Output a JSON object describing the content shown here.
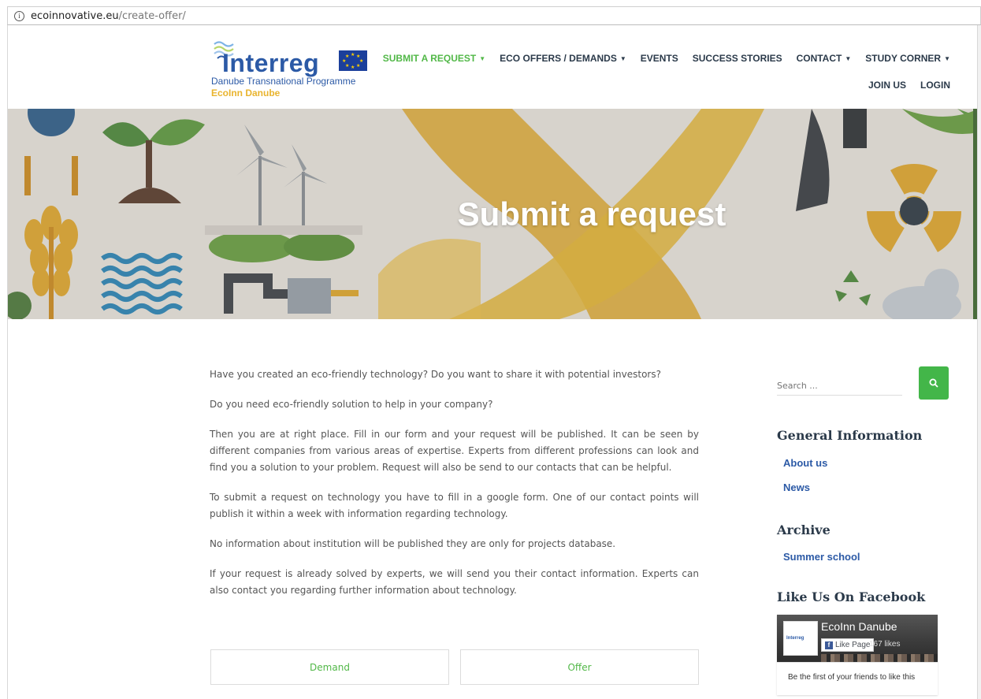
{
  "browser": {
    "url_domain": "ecoinnovative.eu",
    "url_path": "/create-offer/"
  },
  "logo": {
    "word": "Interreg",
    "programme": "Danube Transnational Programme",
    "project": "EcoInn Danube"
  },
  "nav": {
    "row1": [
      {
        "label": "SUBMIT A REQUEST",
        "dropdown": true,
        "active": true
      },
      {
        "label": "ECO OFFERS / DEMANDS",
        "dropdown": true,
        "active": false
      },
      {
        "label": "EVENTS",
        "dropdown": false,
        "active": false
      },
      {
        "label": "SUCCESS STORIES",
        "dropdown": false,
        "active": false
      },
      {
        "label": "CONTACT",
        "dropdown": true,
        "active": false
      },
      {
        "label": "STUDY CORNER",
        "dropdown": true,
        "active": false
      }
    ],
    "row2": [
      {
        "label": "JOIN US"
      },
      {
        "label": "LOGIN"
      }
    ],
    "caret": "▼"
  },
  "hero": {
    "title": "Submit a request"
  },
  "content": {
    "paragraphs": [
      "Have you created an eco-friendly technology? Do you want to share it with potential investors?",
      "Do you need eco-friendly solution to help in your company?",
      "Then you are at right place. Fill in our form and your request will be published. It can be seen by different companies from various areas of expertise. Experts from different professions can look and find you a solution to your problem. Request will also be send to our contacts that can be helpful.",
      "To submit a request on technology you have to fill in a google form. One of our contact points will publish it within a week with information regarding technology.",
      "No information about institution will be published they are only for projects database.",
      "If your request is already solved by experts, we will send you their contact information. Experts can also contact you regarding further information about technology."
    ],
    "buttons": {
      "demand": "Demand",
      "offer": "Offer"
    }
  },
  "sidebar": {
    "search_placeholder": "Search ...",
    "general_title": "General Information",
    "general_links": [
      "About us",
      "News"
    ],
    "archive_title": "Archive",
    "archive_links": [
      "Summer school"
    ],
    "facebook_title": "Like Us On Facebook",
    "facebook": {
      "page_name": "EcoInn Danube",
      "like_label": "Like Page",
      "likes": "167 likes",
      "friends_text": "Be the first of your friends to like this",
      "thumb_text": "Interreg"
    }
  },
  "colors": {
    "accent_green": "#52b848",
    "brand_blue": "#2c5aa6",
    "brand_yellow": "#e9b42e",
    "nav_dark": "#2b3a4a"
  }
}
